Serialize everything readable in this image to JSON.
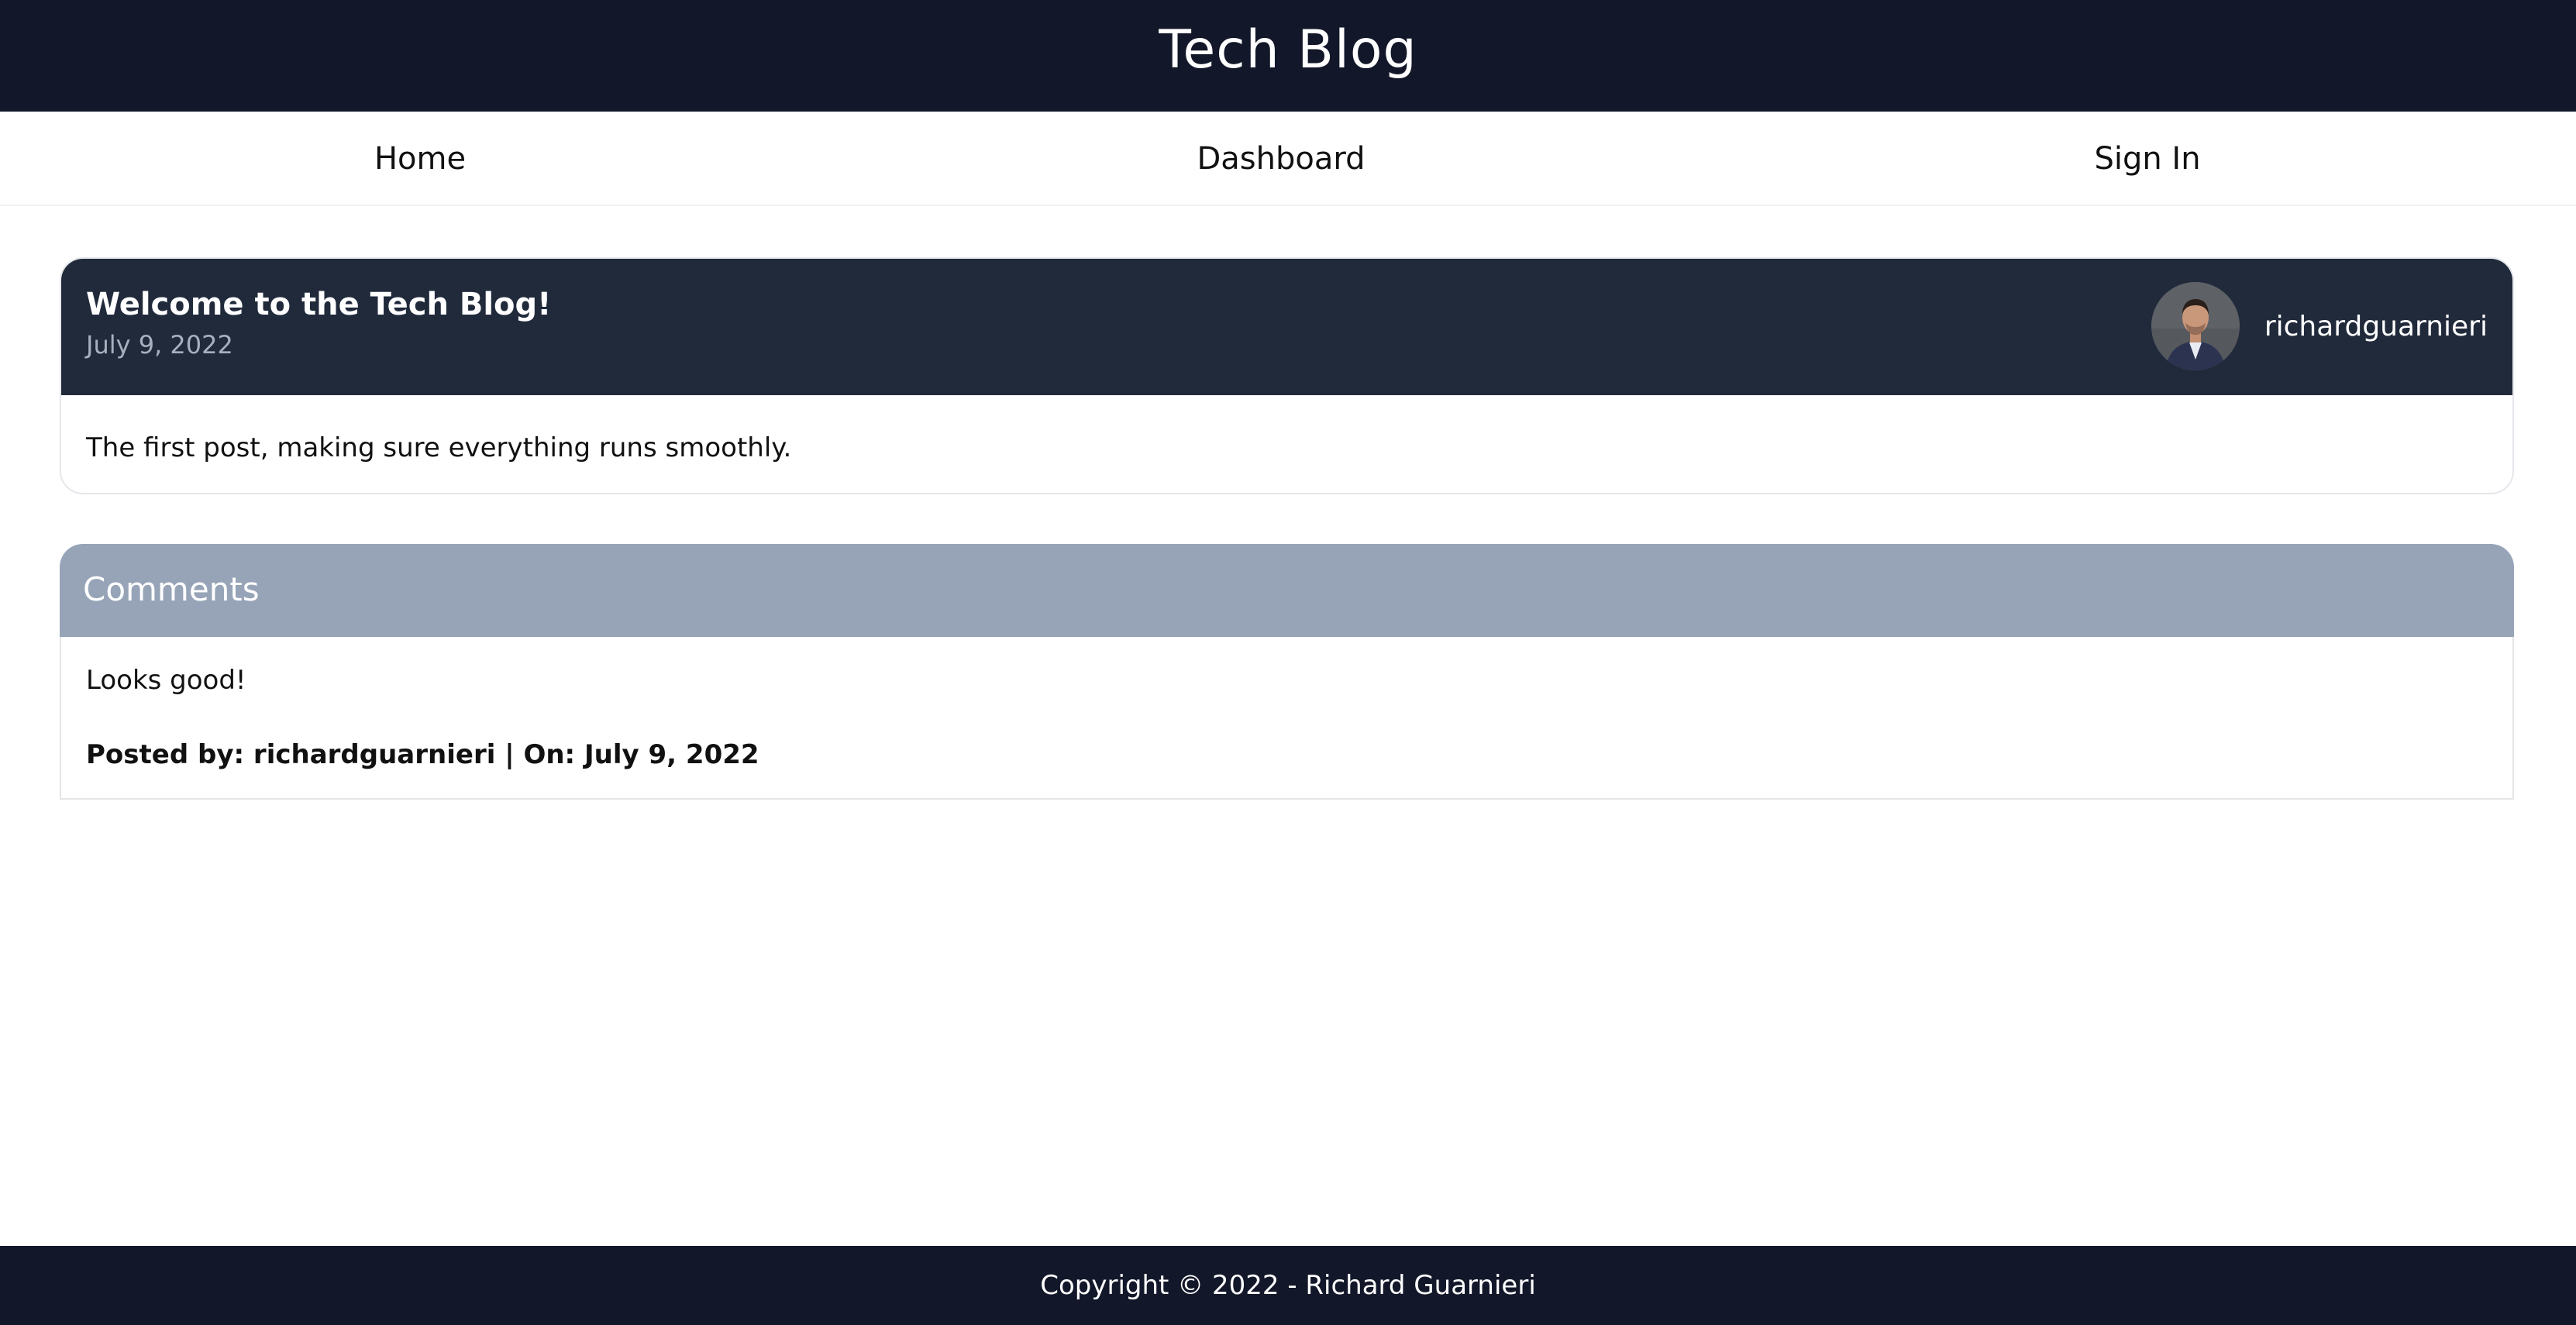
{
  "header": {
    "title": "Tech Blog"
  },
  "nav": {
    "home": "Home",
    "dashboard": "Dashboard",
    "sign_in": "Sign In"
  },
  "post": {
    "title": "Welcome to the Tech Blog!",
    "date": "July 9, 2022",
    "author": "richardguarnieri",
    "body": "The first post, making sure everything runs smoothly."
  },
  "comments": {
    "heading": "Comments",
    "items": [
      {
        "text": "Looks good!",
        "meta": "Posted by: richardguarnieri | On: July 9, 2022"
      }
    ]
  },
  "footer": {
    "copyright": "Copyright © 2022 - Richard Guarnieri"
  },
  "colors": {
    "header_bg": "#121729",
    "post_header_bg": "#202a3b",
    "comments_header_bg": "#97a4b8",
    "footer_bg": "#121729"
  }
}
